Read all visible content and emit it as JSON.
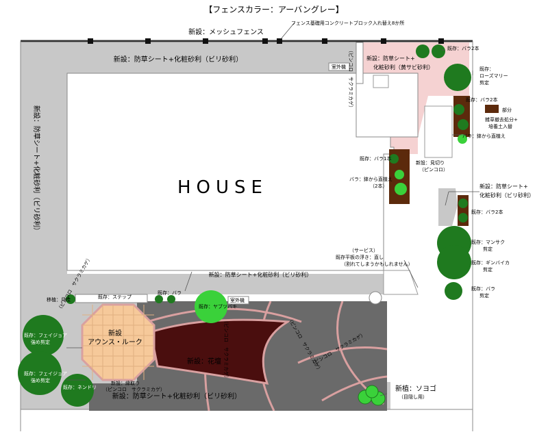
{
  "title": "【フェンスカラー：アーバングレー】",
  "labels": {
    "fence_new": "新設：メッシュフェンス",
    "fence_block": "フェンス基礎用コンクリートブロック入れ替え8か所",
    "top_sheet": "新設：防草シート+化粧砂利（ビリ砂利）",
    "left_sheet": "新設：防草シート+化粧砂利（ビリ砂利）",
    "pink_sheet_1": "新設：防草シート+",
    "pink_sheet_2": "化粧砂利（黄サビ砂利）",
    "house": "HOUSE",
    "outdoor_unit_1": "室外機",
    "outdoor_unit_2": "室外機",
    "pinkoro_vertical": "（ピンコロ　サクラミカゲ）",
    "existing_rose_2_top": "既存：バラ2本",
    "existing_rosemary_1": "既存：",
    "existing_rosemary_2": "ローズマリー",
    "existing_rosemary_3": "剪定",
    "existing_rose_2_mid": "既存：バラ2本",
    "legend_part": "部分",
    "weed_1": "雑草撤去処分+",
    "weed_2": "培養土入替",
    "pot_rose_replant": "バラ：鉢から直植え",
    "existing_rose_1": "既存：バラ1本",
    "new_mikiri_1": "新設：見切り",
    "new_mikiri_2": "（ピンコロ）",
    "rose_pot_1": "バラ：鉢から直植え",
    "rose_pot_2": "（2本）",
    "right_sheet_1": "新設：防草シート+",
    "right_sheet_2": "化粧砂利（ビリ砂利）",
    "existing_rose_2_right": "既存：バラ2本",
    "mansaku_1": "既存：マンサク",
    "mansaku_2": "剪定",
    "ginbaika_1": "既存：ギンバイカ",
    "ginbaika_2": "剪定",
    "rose_prune_1": "既存：バラ",
    "rose_prune_2": "剪定",
    "service_1": "（サービス）",
    "service_2": "既存平板の浮き：直し",
    "service_3": "（割れてしまうかもしれません）",
    "mid_sheet": "新設：防草シート+化粧砂利（ビリ砂利）",
    "transplant": "移植：月桂",
    "step": "既存：ステップ",
    "existing_rose_small": "既存：バラ",
    "camellia": "既存：ヤブツバキ",
    "approach_1": "新設",
    "approach_2": "アウンス・ルーク",
    "feijoa_1a": "既存：フェイジョア",
    "feijoa_1b": "強め剪定",
    "feijoa_2a": "既存：フェイジョア",
    "feijoa_2b": "強め剪定",
    "existing_tree": "既存：ネンドリ",
    "new_edge": "新設：縁取り",
    "edge_sub": "（ピンコロ　サクラミカゲ）",
    "pinkoro_a": "（ピンコロ　サクラミカゲ）",
    "pinkoro_b": "（ピンコロ　サクラミカゲ）",
    "pinkoro_c": "（ピンコロ　サクラミカゲ）",
    "pinkoro_d": "（ピンコロ　サクラミカゲ）",
    "flowerbed": "新設：花壇",
    "bottom_sheet": "新設：防草シート+化粧砂利（ビリ砂利）",
    "soyogo_1": "新植：ソヨゴ",
    "soyogo_2": "（目隠し用）"
  },
  "colors": {
    "gravel": "#c8c8c8",
    "pink_gravel": "#f5d2d2",
    "paving": "#6a6a6a",
    "flowerbed": "#4a0e0e",
    "pinkoro": "#d9a0a0",
    "approach": "#f6c99a",
    "soil": "#5c2a0c",
    "tree": "#1f7a1f",
    "new_tree": "#3ad13a",
    "fence": "#333333"
  }
}
